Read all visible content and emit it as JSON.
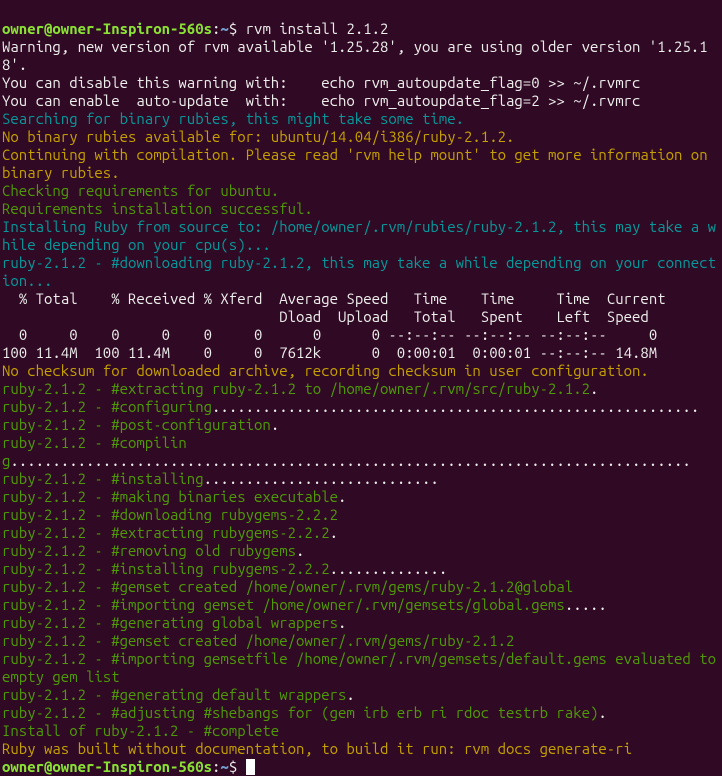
{
  "prompt": {
    "user": "owner@owner-Inspiron-560s",
    "sep": ":",
    "path": "~",
    "end": "$ "
  },
  "command": "rvm install 2.1.2",
  "lines": [
    {
      "cls": "white",
      "t": "Warning, new version of rvm available '1.25.28', you are using older version '1.25.18'."
    },
    {
      "cls": "white",
      "t": "You can disable this warning with:    echo rvm_autoupdate_flag=0 >> ~/.rvmrc"
    },
    {
      "cls": "white",
      "t": "You can enable  auto-update  with:    echo rvm_autoupdate_flag=2 >> ~/.rvmrc"
    },
    {
      "cls": "teal",
      "t": "Searching for binary rubies, this might take some time."
    },
    {
      "cls": "yellow",
      "t": "No binary rubies available for: ubuntu/14.04/i386/ruby-2.1.2."
    },
    {
      "cls": "yellow",
      "t": "Continuing with compilation. Please read 'rvm help mount' to get more information on binary rubies."
    },
    {
      "cls": "green",
      "t": "Checking requirements for ubuntu."
    },
    {
      "cls": "green",
      "t": "Requirements installation successful."
    },
    {
      "cls": "teal",
      "t": "Installing Ruby from source to: /home/owner/.rvm/rubies/ruby-2.1.2, this may take a while depending on your cpu(s)..."
    },
    {
      "cls": "teal",
      "t": "ruby-2.1.2 - #downloading ruby-2.1.2, this may take a while depending on your connection..."
    },
    {
      "cls": "white",
      "t": "  % Total    % Received % Xferd  Average Speed   Time    Time     Time  Current"
    },
    {
      "cls": "white",
      "t": "                                 Dload  Upload   Total   Spent    Left  Speed"
    },
    {
      "cls": "white",
      "t": "  0     0    0     0    0     0      0      0 --:--:-- --:--:-- --:--:--     0"
    },
    {
      "cls": "white",
      "t": "100 11.4M  100 11.4M    0     0  7612k      0  0:00:01  0:00:01 --:--:-- 14.8M"
    },
    {
      "cls": "yellow",
      "t": "No checksum for downloaded archive, recording checksum in user configuration."
    }
  ],
  "steps": [
    {
      "pre": "ruby-2.1.2 - #",
      "act": "extracting ruby-2.1.2 to /home/owner/.rvm/src/ruby-2.1.2",
      "dots": "."
    },
    {
      "pre": "ruby-2.1.2 - #",
      "act": "configuring",
      "dots": ".........................................................."
    },
    {
      "pre": "ruby-2.1.2 - #",
      "act": "post-configuration",
      "dots": "."
    },
    {
      "pre": "ruby-2.1.2 - #",
      "act": "compiling",
      "dots": "................................................................................."
    },
    {
      "pre": "ruby-2.1.2 - #",
      "act": "installing",
      "dots": "............................"
    },
    {
      "pre": "ruby-2.1.2 - #",
      "act": "making binaries executable",
      "dots": "."
    },
    {
      "pre": "ruby-2.1.2 - #",
      "act": "downloading rubygems-2.2.2",
      "dots": ""
    },
    {
      "pre": "ruby-2.1.2 - #",
      "act": "extracting rubygems-2.2.2",
      "dots": "."
    },
    {
      "pre": "ruby-2.1.2 - #",
      "act": "removing old rubygems",
      "dots": "."
    },
    {
      "pre": "ruby-2.1.2 - #",
      "act": "installing rubygems-2.2.2",
      "dots": ".............."
    },
    {
      "pre": "ruby-2.1.2 - #",
      "act": "gemset created /home/owner/.rvm/gems/ruby-2.1.2@global",
      "dots": ""
    },
    {
      "pre": "ruby-2.1.2 - #",
      "act": "importing gemset /home/owner/.rvm/gemsets/global.gems",
      "dots": "....."
    },
    {
      "pre": "ruby-2.1.2 - #",
      "act": "generating global wrappers",
      "dots": "."
    },
    {
      "pre": "ruby-2.1.2 - #",
      "act": "gemset created /home/owner/.rvm/gems/ruby-2.1.2",
      "dots": ""
    },
    {
      "pre": "ruby-2.1.2 - #",
      "act": "importing gemsetfile /home/owner/.rvm/gemsets/default.gems evaluated to empty gem list",
      "dots": ""
    },
    {
      "pre": "ruby-2.1.2 - #",
      "act": "generating default wrappers",
      "dots": "."
    },
    {
      "pre": "ruby-2.1.2 - #",
      "act": "adjusting #shebangs for (gem irb erb ri rdoc testrb rake)",
      "dots": "."
    }
  ],
  "final": [
    {
      "cls": "green",
      "t": "Install of ruby-2.1.2 - #complete "
    },
    {
      "cls": "yellow",
      "t": "Ruby was built without documentation, to build it run: rvm docs generate-ri"
    }
  ]
}
